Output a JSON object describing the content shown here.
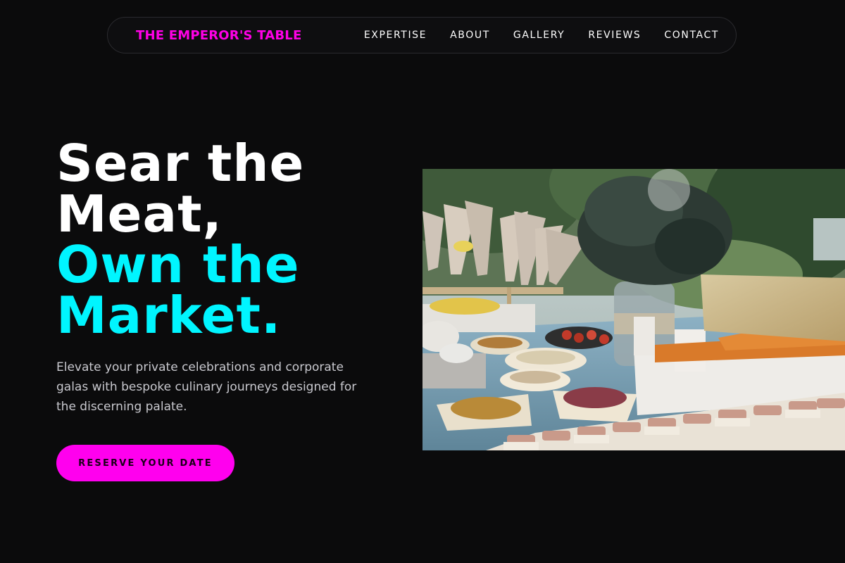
{
  "nav": {
    "brand": "THE EMPEROR'S TABLE",
    "links": [
      "EXPERTISE",
      "ABOUT",
      "GALLERY",
      "REVIEWS",
      "CONTACT"
    ]
  },
  "hero": {
    "title_lines_white": [
      "Sear the",
      "Meat,"
    ],
    "title_lines_cyan": [
      "Own the",
      "Market."
    ],
    "description": "Elevate your private celebrations and corporate galas with bespoke culinary journeys designed for the discerning palate.",
    "cta_label": "RESERVE YOUR DATE"
  },
  "colors": {
    "background": "#0b0b0c",
    "brand_magenta": "#ff00e6",
    "accent_cyan": "#00f5ff",
    "cta_magenta": "#ff00ee"
  }
}
